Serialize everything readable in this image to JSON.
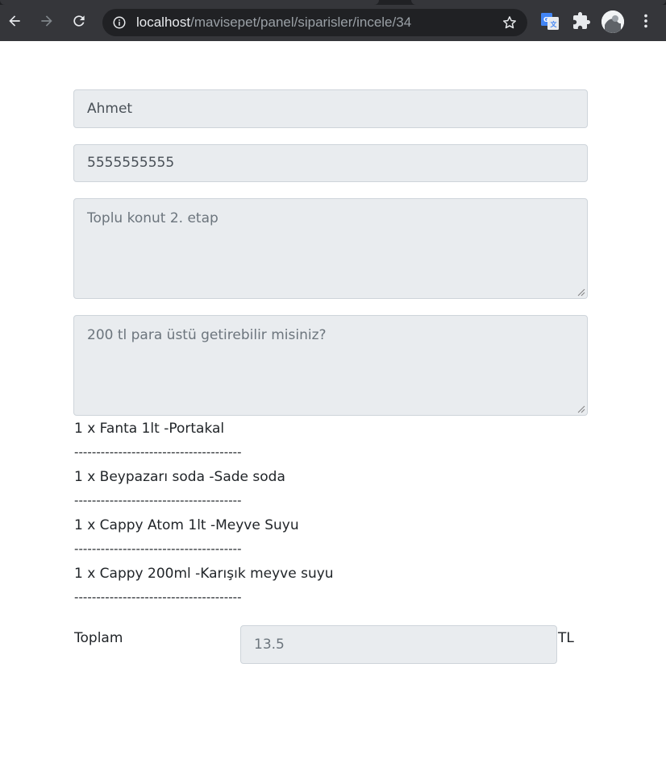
{
  "browser": {
    "url_host": "localhost",
    "url_path": "/mavisepet/panel/siparisler/incele/34"
  },
  "order": {
    "customer_name": "Ahmet",
    "phone": "5555555555",
    "address": "Toplu konut 2. etap",
    "note": "200 tl para üstü getirebilir misiniz?",
    "items": [
      "1 x Fanta 1lt -Portakal",
      "1 x Beypazarı soda -Sade soda",
      "1 x Cappy Atom 1lt -Meyve Suyu",
      "1 x Cappy 200ml -Karışık meyve suyu"
    ],
    "separator": "--------------------------------------",
    "total_label": "Toplam",
    "total_value": "13.5",
    "currency": "TL"
  },
  "colors": {
    "chrome_bg": "#35363a",
    "omnibox_bg": "#202124",
    "readonly_field_bg": "#e9ecef",
    "field_border": "#ced4da",
    "text": "#212529"
  },
  "icons": {
    "back": "arrow-left-icon",
    "forward": "arrow-right-icon",
    "reload": "reload-icon",
    "site_info": "info-icon",
    "bookmark": "star-icon",
    "translate": "google-translate-icon",
    "extensions": "puzzle-icon",
    "profile": "avatar",
    "menu": "kebab-menu-icon"
  }
}
